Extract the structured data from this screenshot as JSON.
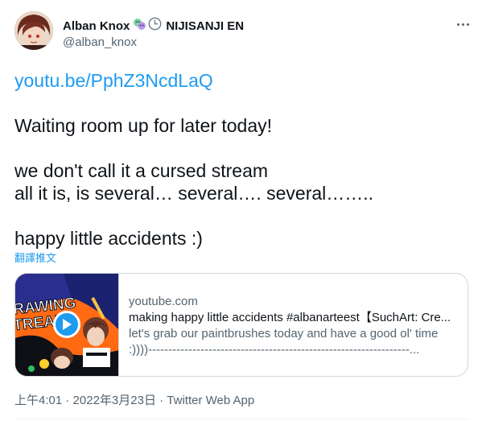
{
  "user": {
    "display_name": "Alban Knox",
    "badge_icons": [
      "mask-icon",
      "clock-icon"
    ],
    "affiliation": "NIJISANJI EN",
    "handle": "@alban_knox"
  },
  "tweet": {
    "link_text": "youtu.be/PphZ3NcdLaQ",
    "lines": [
      "Waiting room up for later today!",
      "we don't call it a cursed stream",
      "all it is, is several… several…. several……..",
      "happy little accidents :)"
    ],
    "translate_label": "翻譯推文"
  },
  "card": {
    "domain": "youtube.com",
    "title": "making happy little accidents #albanarteest【SuchArt: Cre...",
    "description_line1": "let's grab our paintbrushes today and have a good ol' time",
    "description_line2": ":))))-----------------------------------------------------------------...",
    "thumbnail_text_line1": "RAWING",
    "thumbnail_text_line2": "TREAM"
  },
  "meta": {
    "time": "上午4:01",
    "separator": " · ",
    "date": "2022年3月23日",
    "app": "Twitter Web App"
  },
  "colors": {
    "link": "#1d9bf0",
    "text": "#0f1419",
    "muted": "#536471",
    "border": "#cfd9de"
  }
}
